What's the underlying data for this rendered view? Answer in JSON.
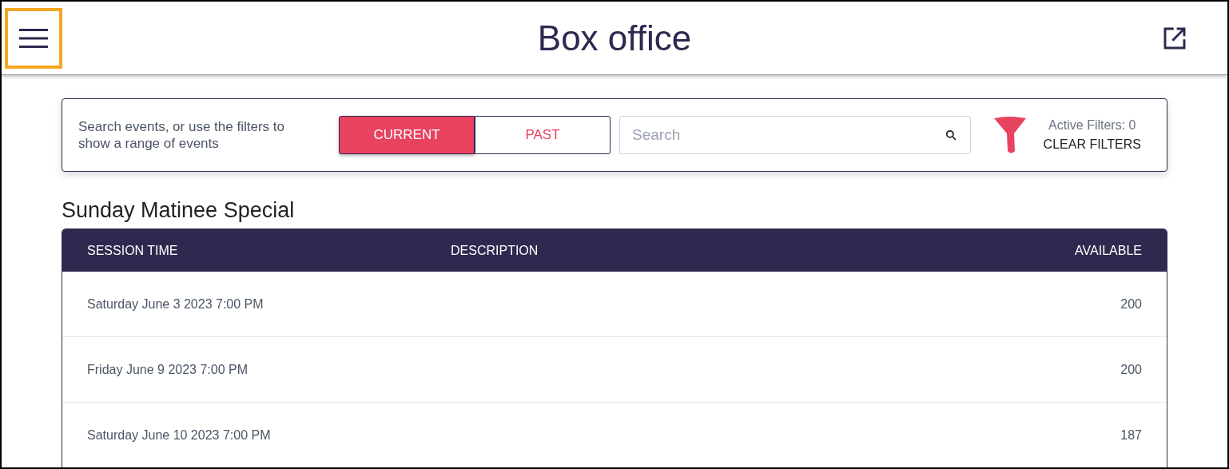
{
  "header": {
    "title": "Box office",
    "menu_highlighted": true
  },
  "filters": {
    "hint": "Search events, or use the filters to show a range of events",
    "tabs": [
      {
        "label": "CURRENT",
        "selected": true
      },
      {
        "label": "PAST",
        "selected": false
      }
    ],
    "search": {
      "placeholder": "Search"
    },
    "active_filters": "Active Filters: 0",
    "clear": "CLEAR FILTERS"
  },
  "event": {
    "title": "Sunday Matinee Special",
    "columns": [
      "SESSION TIME",
      "DESCRIPTION",
      "AVAILABLE"
    ],
    "rows": [
      {
        "time": "Saturday June 3 2023 7:00 PM",
        "available": "200"
      },
      {
        "time": "Friday June 9 2023 7:00 PM",
        "available": "200"
      },
      {
        "time": "Saturday June 10 2023 7:00 PM",
        "available": "187"
      }
    ]
  }
}
